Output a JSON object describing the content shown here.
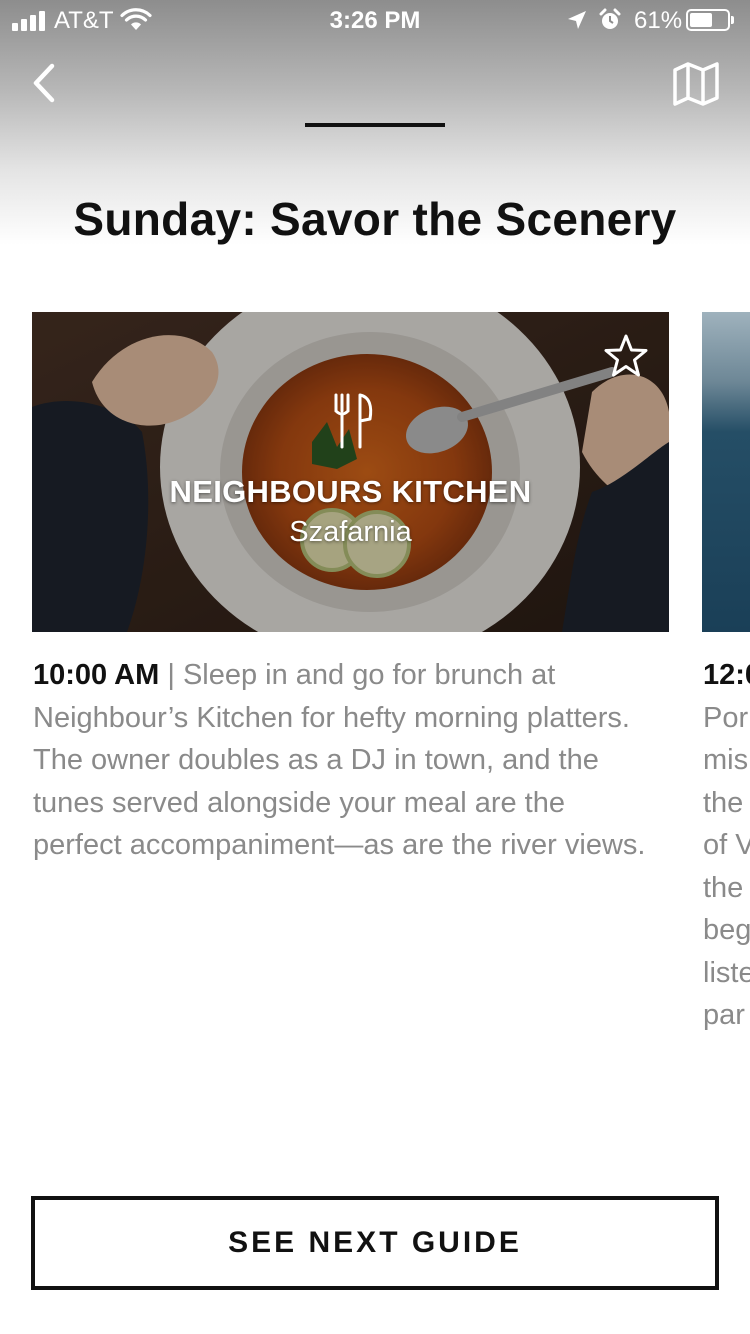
{
  "status_bar": {
    "carrier": "AT&T",
    "time": "3:26 PM",
    "battery": "61%",
    "battery_level": 0.61
  },
  "header": {
    "back_icon": "chevron-left-icon",
    "map_icon": "map-icon"
  },
  "page_title": "Sunday: Savor the Scenery",
  "cards": [
    {
      "category_icon": "fork-knife-icon",
      "name": "NEIGHBOURS KITCHEN",
      "area": "Szafarnia",
      "favorite_icon": "star-outline-icon",
      "time": "10:00 AM",
      "separator": "|",
      "description": "Sleep in and go for brunch at Neighbour’s Kitchen for hefty morning platters. The owner doubles as a DJ in town, and the tunes served alongside your meal are the perfect accompaniment—as are the river views."
    },
    {
      "time_partial": "12:0",
      "lines_partial": [
        "Por",
        "mis",
        "the",
        "of V",
        "the",
        "beg",
        "liste",
        "par"
      ]
    }
  ],
  "footer": {
    "next_button": "SEE NEXT GUIDE"
  },
  "colors": {
    "text": "#111111",
    "muted_text": "#8a8a8a",
    "background": "#ffffff"
  }
}
